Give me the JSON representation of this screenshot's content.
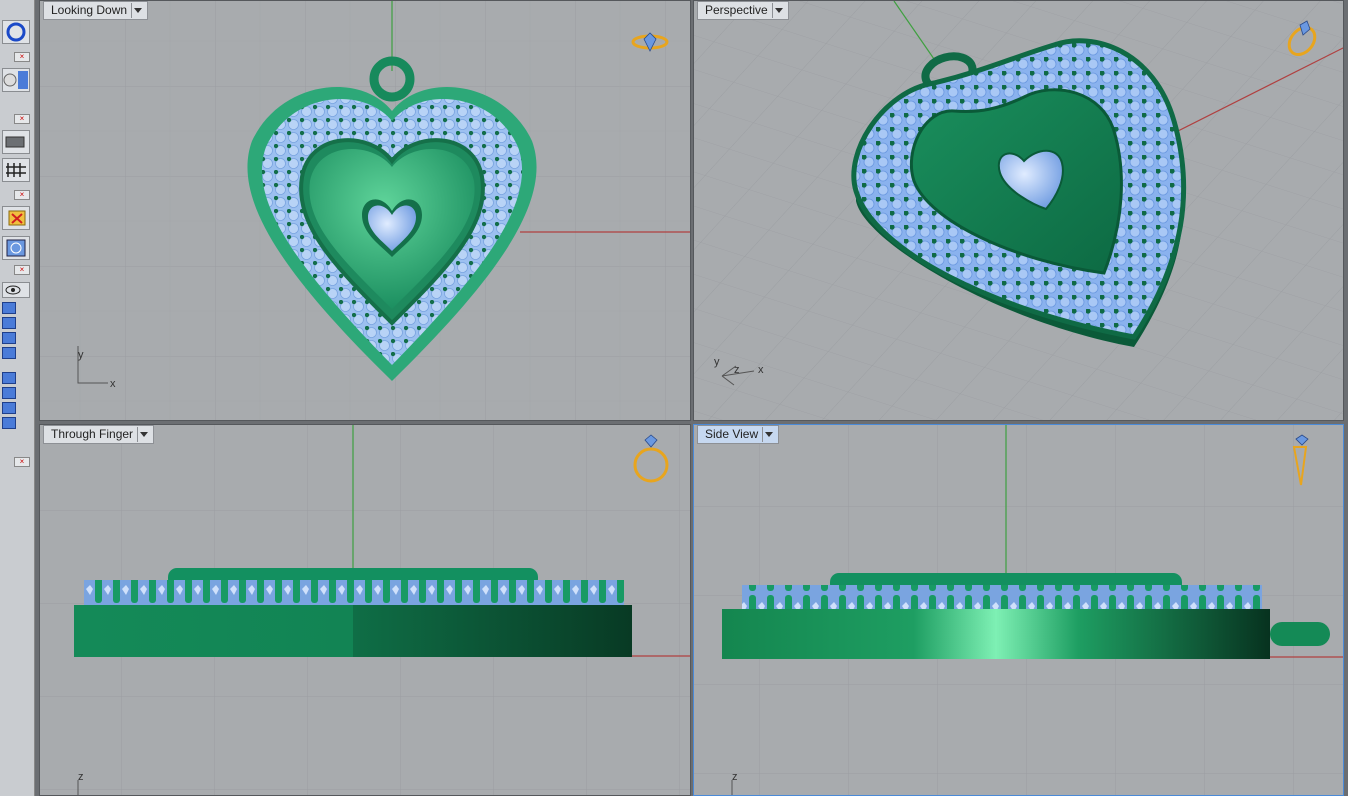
{
  "viewports": {
    "top_left": {
      "title": "Looking Down",
      "axis_labels": [
        "y",
        "x"
      ],
      "icon": "ring-top-icon"
    },
    "top_right": {
      "title": "Perspective",
      "axis_labels": [
        "y",
        "z",
        "x"
      ],
      "icon": "ring-perspective-icon"
    },
    "bottom_left": {
      "title": "Through Finger",
      "axis_labels": [
        "z"
      ],
      "icon": "ring-front-icon"
    },
    "bottom_right": {
      "title": "Side View",
      "axis_labels": [
        "z"
      ],
      "icon": "ring-side-icon"
    }
  },
  "toolbar": {
    "icons": [
      "circle-tool-icon",
      "material-ball-icon",
      "layer-icon",
      "grid-icon",
      "delete-icon",
      "render-icon",
      "visibility-icon"
    ],
    "close_glyph": "×"
  },
  "colors": {
    "viewport_bg": "#a8abae",
    "grid": "#9a9da1",
    "metal": "#1f9a6a",
    "gem": "#8fb6ee",
    "x_axis": "#b04040",
    "y_axis": "#3fa040",
    "icon_gold": "#e8a51e"
  }
}
